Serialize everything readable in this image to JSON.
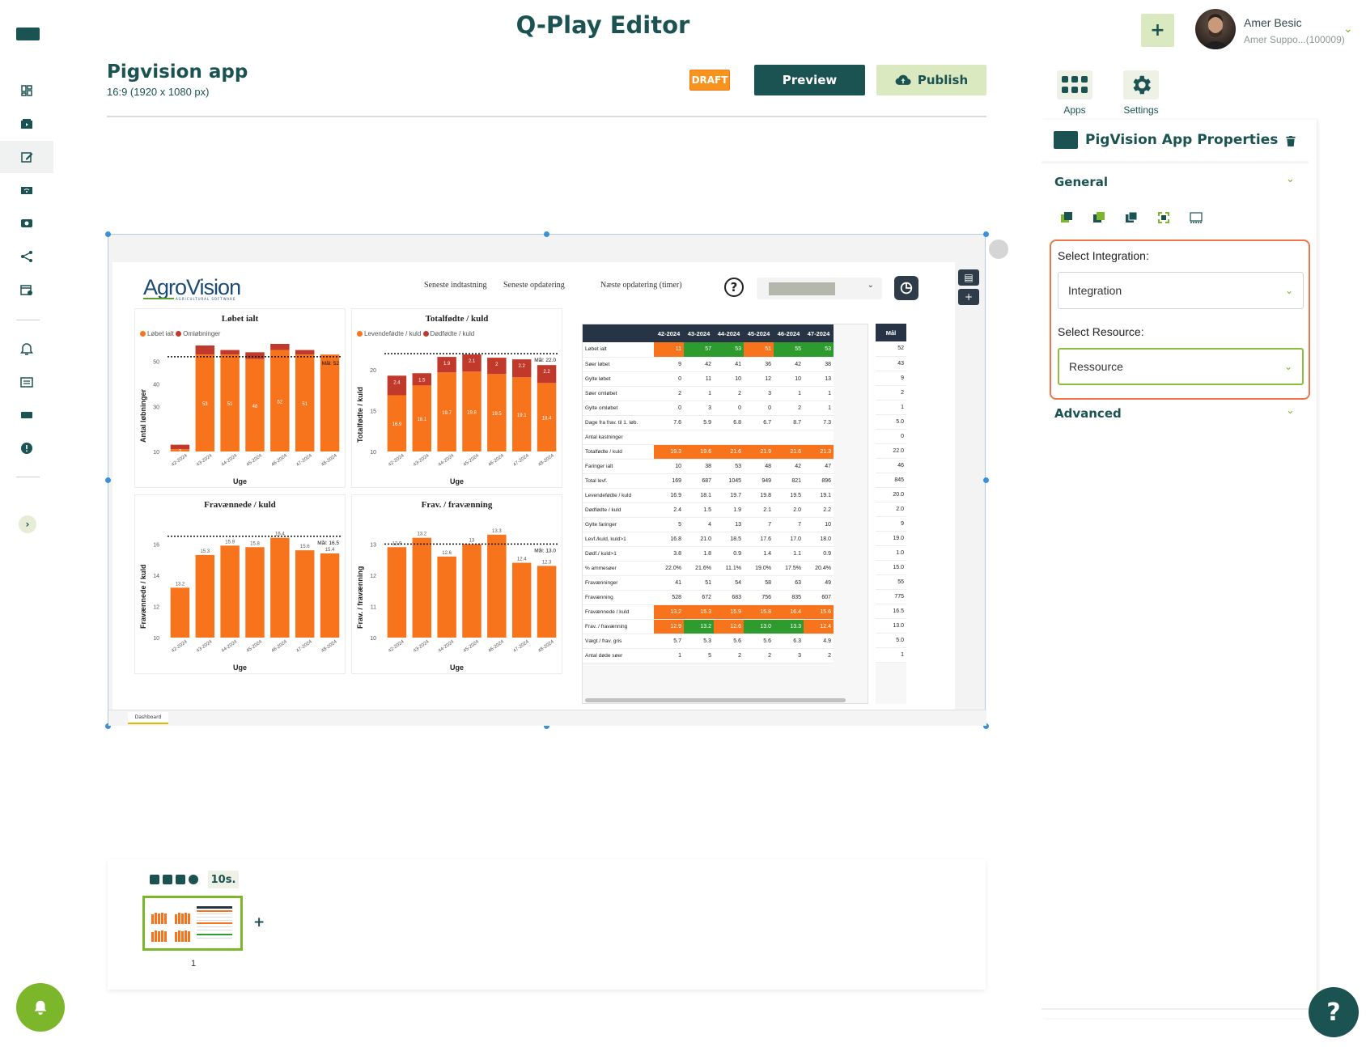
{
  "app": {
    "title": "Q-Play Editor"
  },
  "user": {
    "name": "Amer Besic",
    "subtitle": "Amer Suppo...(100009)"
  },
  "project": {
    "title": "Pigvision app",
    "resolution": "16:9 (1920 x 1080 px)",
    "status_badge": "DRAFT",
    "preview_label": "Preview",
    "publish_label": "Publish"
  },
  "sidebar": {
    "items": [
      {
        "icon": "dashboard-icon"
      },
      {
        "icon": "media-icon"
      },
      {
        "icon": "editor-icon"
      },
      {
        "icon": "wifi-icon"
      },
      {
        "icon": "screen-icon"
      },
      {
        "icon": "share-icon"
      },
      {
        "icon": "schedule-icon"
      },
      {
        "icon": "alarm-icon"
      },
      {
        "icon": "report-icon"
      },
      {
        "icon": "device-icon"
      },
      {
        "icon": "alert-icon"
      }
    ],
    "active_index": 2
  },
  "dashboard": {
    "logo_text": "AgroVision",
    "logo_sub": "AGRICULTURAL SOFTWARE",
    "labels": [
      "Seneste indtastning",
      "Seneste opdatering",
      "Næste opdatering (timer)"
    ],
    "help_symbol": "?",
    "tab": "Dashboard",
    "charts": [
      {
        "title": "Løbet ialt",
        "ylabel": "Antal løbninger",
        "xlabel": "Uge",
        "legend": [
          "Løbet ialt",
          "Omløbninger"
        ],
        "goal_label": "Mål: 52"
      },
      {
        "title": "Totalfødte / kuld",
        "ylabel": "Totalfødte / kuld",
        "xlabel": "Uge",
        "legend": [
          "Levendefødte / kuld",
          "Dødfødte / kuld"
        ],
        "goal_label": "Mål: 22.0"
      },
      {
        "title": "Fravænnede / kuld",
        "ylabel": "Fravænnede / kuld",
        "xlabel": "Uge",
        "goal_label": "Mål: 16.5"
      },
      {
        "title": "Frav. / fravænning",
        "ylabel": "Frav. / fravænning",
        "xlabel": "Uge",
        "goal_label": "Mål: 13.0"
      }
    ],
    "table": {
      "columns": [
        "42-2024",
        "43-2024",
        "44-2024",
        "45-2024",
        "46-2024",
        "47-2024"
      ],
      "goal_header": "Mål",
      "rows": [
        {
          "label": "Løbet ialt",
          "values": [
            "11",
            "57",
            "53",
            "51",
            "55",
            "53"
          ],
          "goal": "52",
          "colors": [
            "o",
            "g",
            "g",
            "o",
            "g",
            "g"
          ]
        },
        {
          "label": "Søer løbet",
          "values": [
            "9",
            "42",
            "41",
            "36",
            "42",
            "38"
          ],
          "goal": "43"
        },
        {
          "label": "Gylte løbet",
          "values": [
            "0",
            "11",
            "10",
            "12",
            "10",
            "13"
          ],
          "goal": "9"
        },
        {
          "label": "Søer omløbet",
          "values": [
            "2",
            "1",
            "2",
            "3",
            "1",
            "1"
          ],
          "goal": "2"
        },
        {
          "label": "Gylte omløbet",
          "values": [
            "0",
            "3",
            "0",
            "0",
            "2",
            "1"
          ],
          "goal": "1"
        },
        {
          "label": "Dage fra frav. til 1. løb.",
          "values": [
            "7.6",
            "5.9",
            "6.8",
            "6.7",
            "8.7",
            "7.3"
          ],
          "goal": "5.0"
        },
        {
          "label": "Antal kastninger",
          "values": [
            "",
            "",
            "",
            "",
            "",
            ""
          ],
          "goal": "0"
        },
        {
          "label": "Totalfødte / kuld",
          "values": [
            "19.3",
            "19.6",
            "21.6",
            "21.9",
            "21.6",
            "21.3"
          ],
          "goal": "22.0",
          "colors": [
            "o",
            "o",
            "o",
            "o",
            "o",
            "o"
          ]
        },
        {
          "label": "Faringer ialt",
          "values": [
            "10",
            "38",
            "53",
            "48",
            "42",
            "47"
          ],
          "goal": "46"
        },
        {
          "label": "Total levf.",
          "values": [
            "169",
            "687",
            "1045",
            "949",
            "821",
            "896"
          ],
          "goal": "845"
        },
        {
          "label": "Levendefødte / kuld",
          "values": [
            "16.9",
            "18.1",
            "19.7",
            "19.8",
            "19.5",
            "19.1"
          ],
          "goal": "20.0"
        },
        {
          "label": "Dødfødte / kuld",
          "values": [
            "2.4",
            "1.5",
            "1.9",
            "2.1",
            "2.0",
            "2.2"
          ],
          "goal": "2.0"
        },
        {
          "label": "Gylte faringer",
          "values": [
            "5",
            "4",
            "13",
            "7",
            "7",
            "10"
          ],
          "goal": "9"
        },
        {
          "label": "Levf./kuld, kuld>1",
          "values": [
            "16.8",
            "21.0",
            "18.5",
            "17.6",
            "17.0",
            "18.0"
          ],
          "goal": "19.0"
        },
        {
          "label": "Dødf./ kuld>1",
          "values": [
            "3.8",
            "1.8",
            "0.9",
            "1.4",
            "1.1",
            "0.9"
          ],
          "goal": "1.0"
        },
        {
          "label": "% ammesøer",
          "values": [
            "22.0%",
            "21.6%",
            "11.1%",
            "19.0%",
            "17.5%",
            "20.4%"
          ],
          "goal": "15.0"
        },
        {
          "label": "Fravænninger",
          "values": [
            "41",
            "51",
            "54",
            "58",
            "63",
            "49"
          ],
          "goal": "55"
        },
        {
          "label": "Fravænning",
          "values": [
            "528",
            "672",
            "683",
            "756",
            "835",
            "607"
          ],
          "goal": "775"
        },
        {
          "label": "Fravænnede / kuld",
          "values": [
            "13.2",
            "15.3",
            "15.9",
            "15.8",
            "16.4",
            "15.6"
          ],
          "goal": "16.5",
          "colors": [
            "o",
            "o",
            "o",
            "o",
            "o",
            "o"
          ]
        },
        {
          "label": "Frav. / fravænning",
          "values": [
            "12.9",
            "13.2",
            "12.6",
            "13.0",
            "13.3",
            "12.4"
          ],
          "goal": "13.0",
          "colors": [
            "o",
            "g",
            "o",
            "g",
            "g",
            "o"
          ]
        },
        {
          "label": "Vægt / frav. gris",
          "values": [
            "5.7",
            "5.3",
            "5.6",
            "5.6",
            "6.3",
            "4.9"
          ],
          "goal": "5.0"
        },
        {
          "label": "Antal døde søer",
          "values": [
            "1",
            "5",
            "2",
            "2",
            "3",
            "2"
          ],
          "goal": "1"
        }
      ]
    }
  },
  "chart_data": [
    {
      "type": "bar",
      "title": "Løbet ialt",
      "xlabel": "Uge",
      "ylabel": "Antal løbninger",
      "categories": [
        "42-2024",
        "43-2024",
        "44-2024",
        "45-2024",
        "46-2024",
        "47-2024",
        "48-2024"
      ],
      "series": [
        {
          "name": "Løbet ialt",
          "values": [
            11,
            53,
            53,
            51,
            55,
            53,
            53
          ]
        },
        {
          "name": "Omløbninger",
          "values": [
            2,
            4,
            2,
            3,
            3,
            2,
            0
          ]
        }
      ],
      "bar_labels": [
        2,
        53,
        51,
        48,
        52,
        51
      ],
      "top_labels": [
        11,
        53,
        51,
        55,
        53
      ],
      "goal": 52,
      "ylim": [
        10,
        57
      ],
      "yticks": [
        10,
        30,
        40,
        50
      ]
    },
    {
      "type": "bar",
      "title": "Totalfødte / kuld",
      "xlabel": "Uge",
      "ylabel": "Totalfødte / kuld",
      "categories": [
        "42-2024",
        "43-2024",
        "44-2024",
        "45-2024",
        "46-2024",
        "47-2024",
        "48-2024"
      ],
      "series": [
        {
          "name": "Levendefødte / kuld",
          "values": [
            16.9,
            18.1,
            19.7,
            19.8,
            19.5,
            19.1,
            18.4
          ]
        },
        {
          "name": "Dødfødte / kuld",
          "values": [
            2.4,
            1.5,
            1.9,
            2.1,
            2.0,
            2.2,
            2.2
          ]
        }
      ],
      "top_labels": [
        19.3,
        19.6
      ],
      "goal": 22.0,
      "ylim": [
        10,
        23
      ],
      "yticks": [
        10,
        15,
        20
      ]
    },
    {
      "type": "bar",
      "title": "Fravænnede / kuld",
      "xlabel": "Uge",
      "ylabel": "Fravænnede / kuld",
      "categories": [
        "42-2024",
        "43-2024",
        "44-2024",
        "45-2024",
        "46-2024",
        "47-2024",
        "48-2024"
      ],
      "series": [
        {
          "values": [
            13.2,
            15.3,
            15.9,
            15.8,
            16.4,
            15.6,
            15.4
          ]
        }
      ],
      "goal": 16.5,
      "ylim": [
        10,
        16.8
      ],
      "yticks": [
        10,
        12,
        14,
        16
      ]
    },
    {
      "type": "bar",
      "title": "Frav. / fravænning",
      "xlabel": "Uge",
      "ylabel": "Frav. / fravænning",
      "categories": [
        "42-2024",
        "43-2024",
        "44-2024",
        "45-2024",
        "46-2024",
        "47-2024",
        "48-2024"
      ],
      "series": [
        {
          "values": [
            12.9,
            13.2,
            12.6,
            13.0,
            13.3,
            12.4,
            12.3
          ]
        }
      ],
      "goal": 13.0,
      "ylim": [
        10,
        13.4
      ],
      "yticks": [
        10,
        11,
        12,
        13
      ]
    }
  ],
  "timeline": {
    "duration": "10s.",
    "slide_number": "1"
  },
  "panel": {
    "tabs": [
      {
        "label": "Apps"
      },
      {
        "label": "Settings"
      }
    ],
    "title": "PigVision App Properties",
    "general_label": "General",
    "advanced_label": "Advanced",
    "integration_label": "Select Integration:",
    "integration_value": "Integration",
    "resource_label": "Select Resource:",
    "resource_value": "Ressource"
  },
  "colors": {
    "brand": "#1b5252",
    "accent": "#7bb62b",
    "orange": "#f7741c",
    "red": "#c0392b",
    "green": "#2e9b2e"
  }
}
